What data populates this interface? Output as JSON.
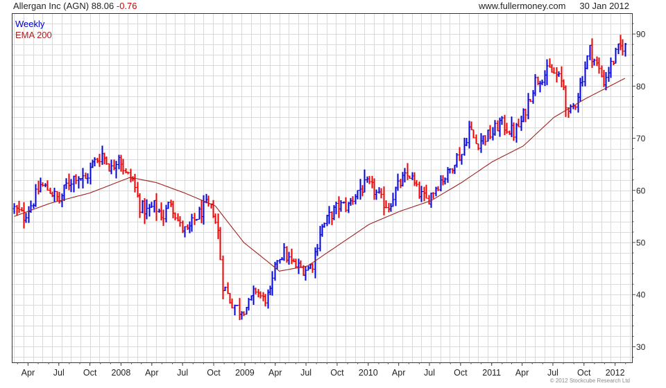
{
  "header": {
    "ticker_title": "Allergan Inc (AGN)",
    "last_price": "88.06",
    "change": "-0.76",
    "website": "www.fullermoney.com",
    "date": "30 Jan 2012"
  },
  "copyright": "© 2012 Stockcube Research Ltd",
  "chart_data": {
    "type": "ohlc",
    "interval": "Weekly",
    "ylim": [
      27,
      94
    ],
    "ytick_values": [
      30,
      40,
      50,
      60,
      70,
      80,
      90
    ],
    "ytick_labels": [
      "30",
      "40",
      "50",
      "60",
      "70",
      "80",
      "90"
    ],
    "yaxis_side": "right",
    "grid": true,
    "xlim": [
      "2007-02-12",
      "2012-02-20"
    ],
    "xticks": [
      {
        "label": "Apr",
        "date": "2007-04-01"
      },
      {
        "label": "Jul",
        "date": "2007-07-01"
      },
      {
        "label": "Oct",
        "date": "2007-10-01"
      },
      {
        "label": "2008",
        "date": "2008-01-01"
      },
      {
        "label": "Apr",
        "date": "2008-04-01"
      },
      {
        "label": "Jul",
        "date": "2008-07-01"
      },
      {
        "label": "Oct",
        "date": "2008-10-01"
      },
      {
        "label": "2009",
        "date": "2009-01-01"
      },
      {
        "label": "Apr",
        "date": "2009-04-01"
      },
      {
        "label": "Jul",
        "date": "2009-07-01"
      },
      {
        "label": "Oct",
        "date": "2009-10-01"
      },
      {
        "label": "2010",
        "date": "2010-01-01"
      },
      {
        "label": "Apr",
        "date": "2010-04-01"
      },
      {
        "label": "Jul",
        "date": "2010-07-01"
      },
      {
        "label": "Oct",
        "date": "2010-10-01"
      },
      {
        "label": "2011",
        "date": "2011-01-01"
      },
      {
        "label": "Apr",
        "date": "2011-04-01"
      },
      {
        "label": "Jul",
        "date": "2011-07-01"
      },
      {
        "label": "Oct",
        "date": "2011-10-01"
      },
      {
        "label": "2012",
        "date": "2012-01-01"
      }
    ],
    "legend": [
      {
        "label": "Weekly",
        "color": "#0000cc"
      },
      {
        "label": "EMA 200",
        "color": "#b02020"
      }
    ],
    "legend_position": "top-left",
    "colors": {
      "up": "#0000dd",
      "down": "#ee0000",
      "ema": "#a02020",
      "grid": "#dadada",
      "axis": "#444444"
    },
    "price_anchors": [
      [
        "2007-02-19",
        56.5
      ],
      [
        "2007-03-19",
        55
      ],
      [
        "2007-04-16",
        58
      ],
      [
        "2007-05-07",
        61
      ],
      [
        "2007-06-04",
        60
      ],
      [
        "2007-07-02",
        58
      ],
      [
        "2007-07-23",
        61
      ],
      [
        "2007-08-20",
        63
      ],
      [
        "2007-09-17",
        62
      ],
      [
        "2007-10-08",
        65
      ],
      [
        "2007-11-05",
        67
      ],
      [
        "2007-12-03",
        64
      ],
      [
        "2007-12-24",
        67
      ],
      [
        "2008-01-14",
        63
      ],
      [
        "2008-02-04",
        62
      ],
      [
        "2008-02-25",
        57
      ],
      [
        "2008-03-17",
        56
      ],
      [
        "2008-04-07",
        57
      ],
      [
        "2008-05-05",
        55
      ],
      [
        "2008-05-26",
        58
      ],
      [
        "2008-06-23",
        53
      ],
      [
        "2008-07-14",
        52
      ],
      [
        "2008-08-11",
        55
      ],
      [
        "2008-09-08",
        57
      ],
      [
        "2008-09-29",
        56
      ],
      [
        "2008-10-13",
        52
      ],
      [
        "2008-10-27",
        42
      ],
      [
        "2008-11-17",
        39
      ],
      [
        "2008-12-15",
        37
      ],
      [
        "2009-01-12",
        38
      ],
      [
        "2009-02-02",
        41
      ],
      [
        "2009-02-23",
        39
      ],
      [
        "2009-03-16",
        40
      ],
      [
        "2009-04-06",
        47
      ],
      [
        "2009-04-27",
        48
      ],
      [
        "2009-05-18",
        46
      ],
      [
        "2009-06-15",
        45
      ],
      [
        "2009-07-06",
        45
      ],
      [
        "2009-07-20",
        46
      ],
      [
        "2009-08-10",
        52
      ],
      [
        "2009-09-07",
        55
      ],
      [
        "2009-10-05",
        57
      ],
      [
        "2009-11-02",
        57
      ],
      [
        "2009-11-30",
        60
      ],
      [
        "2009-12-28",
        61
      ],
      [
        "2010-01-18",
        60
      ],
      [
        "2010-02-08",
        58
      ],
      [
        "2010-03-01",
        57
      ],
      [
        "2010-03-22",
        60
      ],
      [
        "2010-04-12",
        62
      ],
      [
        "2010-05-03",
        63
      ],
      [
        "2010-05-24",
        60
      ],
      [
        "2010-06-21",
        58
      ],
      [
        "2010-07-12",
        60
      ],
      [
        "2010-08-02",
        62
      ],
      [
        "2010-08-23",
        63
      ],
      [
        "2010-09-13",
        66
      ],
      [
        "2010-10-04",
        67
      ],
      [
        "2010-10-25",
        72
      ],
      [
        "2010-11-15",
        69
      ],
      [
        "2010-12-06",
        70
      ],
      [
        "2011-01-03",
        71
      ],
      [
        "2011-01-24",
        73
      ],
      [
        "2011-02-14",
        72
      ],
      [
        "2011-03-07",
        71
      ],
      [
        "2011-03-28",
        73
      ],
      [
        "2011-04-18",
        77
      ],
      [
        "2011-05-09",
        81
      ],
      [
        "2011-05-30",
        82
      ],
      [
        "2011-06-20",
        83
      ],
      [
        "2011-07-11",
        82
      ],
      [
        "2011-08-01",
        80
      ],
      [
        "2011-08-15",
        74
      ],
      [
        "2011-09-05",
        77
      ],
      [
        "2011-09-26",
        82
      ],
      [
        "2011-10-17",
        87
      ],
      [
        "2011-11-07",
        84
      ],
      [
        "2011-11-28",
        81
      ],
      [
        "2011-12-19",
        84
      ],
      [
        "2012-01-09",
        87
      ],
      [
        "2012-01-30",
        88.06
      ]
    ],
    "ema_anchors": [
      [
        "2007-02-19",
        55
      ],
      [
        "2007-06-04",
        57.5
      ],
      [
        "2007-10-01",
        59.5
      ],
      [
        "2008-01-28",
        62.5
      ],
      [
        "2008-04-14",
        61.5
      ],
      [
        "2008-07-07",
        59.5
      ],
      [
        "2008-10-06",
        57
      ],
      [
        "2008-12-29",
        50
      ],
      [
        "2009-03-16",
        46
      ],
      [
        "2009-04-13",
        44.5
      ],
      [
        "2009-07-06",
        45.5
      ],
      [
        "2009-10-05",
        49.5
      ],
      [
        "2010-01-04",
        53.5
      ],
      [
        "2010-04-05",
        56
      ],
      [
        "2010-07-05",
        58
      ],
      [
        "2010-10-04",
        61.5
      ],
      [
        "2011-01-03",
        65.5
      ],
      [
        "2011-04-04",
        68.5
      ],
      [
        "2011-07-04",
        74
      ],
      [
        "2011-10-03",
        77.5
      ],
      [
        "2012-01-30",
        81.5
      ]
    ]
  }
}
